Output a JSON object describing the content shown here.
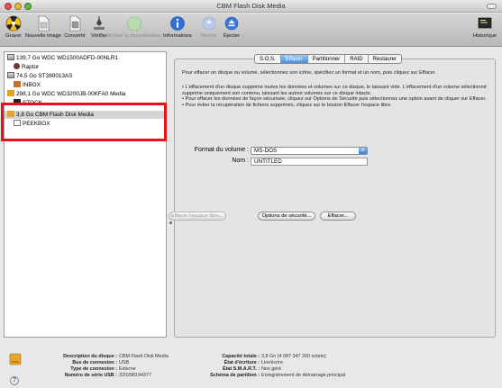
{
  "window": {
    "title": "CBM Flash Disk Media"
  },
  "toolbar": {
    "items": [
      {
        "label": "Graver",
        "icon": "burn-icon"
      },
      {
        "label": "Nouvelle image",
        "icon": "new-image-icon"
      },
      {
        "label": "Convertir",
        "icon": "convert-icon"
      },
      {
        "label": "Vérifier",
        "icon": "verify-icon"
      },
      {
        "label": "Activer la journalisation",
        "icon": "journaling-icon"
      },
      {
        "label": "Informations",
        "icon": "info-icon"
      },
      {
        "label": "Monter",
        "icon": "mount-icon"
      },
      {
        "label": "Éjecter",
        "icon": "eject-icon"
      },
      {
        "label": "Historique",
        "icon": "log-icon"
      }
    ]
  },
  "sidebar": {
    "items": [
      {
        "label": "139,7 Go WDC WD1500ADFD-00NLR1",
        "level": 0,
        "icon": "hard-disk-icon"
      },
      {
        "label": "Raptor",
        "level": 1,
        "icon": "volume-icon"
      },
      {
        "label": "74,5 Go ST380013AS",
        "level": 0,
        "icon": "hard-disk-icon"
      },
      {
        "label": "INBOX",
        "level": 1,
        "icon": "volume-icon"
      },
      {
        "label": "298,1 Go WDC WD3200JB-00KFA0 Media",
        "level": 0,
        "icon": "hard-disk-icon"
      },
      {
        "label": "STOCK",
        "level": 1,
        "icon": "volume-icon"
      },
      {
        "label": "3,8 Go CBM Flash Disk Media",
        "level": 0,
        "icon": "usb-disk-icon",
        "selected": true
      },
      {
        "label": "PEEKBOX",
        "level": 1,
        "icon": "volume-icon"
      }
    ]
  },
  "tabs": [
    {
      "label": "S.O.S."
    },
    {
      "label": "Effacer",
      "active": true
    },
    {
      "label": "Partitionner"
    },
    {
      "label": "RAID"
    },
    {
      "label": "Restaurer"
    }
  ],
  "erase": {
    "intro": "Pour effacer un disque ou volume, sélectionnez son icône, spécifiez un format et un nom, puis cliquez sur Effacer.",
    "bullets": [
      "• L'effacement d'un disque supprime toutes les données et volumes sur ce disque, le laissant vide. L'effacement d'un volume sélectionné supprime uniquement son contenu, laissant les autres volumes sur ce disque intacts.",
      "• Pour effacer les données de façon sécurisée, cliquez sur Options de Sécurité puis sélectionnez une option avant de cliquer sur Effacer.",
      "• Pour éviter la récupération de fichiers supprimés, cliquez sur le bouton Effacer l'espace libre."
    ],
    "format_label": "Format du volume :",
    "format_value": "MS-DOS",
    "name_label": "Nom :",
    "name_value": "UNTITLED",
    "free_space_button": "Effacer l'espace libre...",
    "security_button": "Options de sécurité...",
    "erase_button": "Effacer..."
  },
  "info": {
    "left": [
      {
        "key": "Description du disque :",
        "value": "CBM Flash Disk Media"
      },
      {
        "key": "Bus de connexion :",
        "value": "USB"
      },
      {
        "key": "Type de connexion :",
        "value": "Externe"
      },
      {
        "key": "Numéro de série USB :",
        "value": "320298194377"
      }
    ],
    "right": [
      {
        "key": "Capacité totale :",
        "value": "3,8 Go (4 087 347 200 octets)"
      },
      {
        "key": "État d'écriture :",
        "value": "Lire/écrire"
      },
      {
        "key": "État S.M.A.R.T. :",
        "value": "Non géré"
      },
      {
        "key": "Schéma de partition :",
        "value": "Enregistrement de démarrage principal"
      }
    ],
    "help_label": "?"
  },
  "colors": {
    "highlight": "#e3131b",
    "tab_active": "#4b8fdf"
  }
}
